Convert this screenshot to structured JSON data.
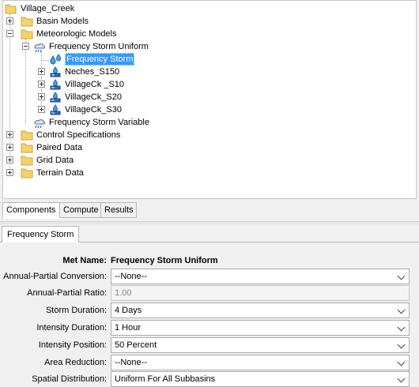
{
  "tree": {
    "root": "Village_Creek",
    "basin_models": "Basin Models",
    "meteorologic_models": "Meteorologic Models",
    "freq_storm_uniform": "Frequency Storm Uniform",
    "frequency_storm": "Frequency Storm",
    "neches_s150": "Neches_S150",
    "villageck_s10": "VillageCk _S10",
    "villageck_s20": "VillageCk_S20",
    "villageck_s30": "VillageCk_S30",
    "freq_storm_variable": "Frequency Storm Variable",
    "control_specifications": "Control Specifications",
    "paired_data": "Paired Data",
    "grid_data": "Grid Data",
    "terrain_data": "Terrain Data"
  },
  "tabs": {
    "components": "Components",
    "compute": "Compute",
    "results": "Results"
  },
  "editor": {
    "tab_title": "Frequency Storm",
    "met_name_label": "Met Name:",
    "met_name_value": "Frequency Storm Uniform",
    "annual_partial_conversion_label": "Annual-Partial Conversion:",
    "annual_partial_conversion_value": "--None--",
    "annual_partial_ratio_label": "Annual-Partial Ratio:",
    "annual_partial_ratio_value": "1.00",
    "storm_duration_label": "Storm Duration:",
    "storm_duration_value": "4 Days",
    "intensity_duration_label": "Intensity Duration:",
    "intensity_duration_value": "1 Hour",
    "intensity_position_label": "Intensity Position:",
    "intensity_position_value": "50 Percent",
    "area_reduction_label": "Area Reduction:",
    "area_reduction_value": "--None--",
    "spatial_distribution_label": "Spatial Distribution:",
    "spatial_distribution_value": "Uniform For All Subbasins"
  },
  "colors": {
    "selection": "#3399ff",
    "folder": "#f5d36b",
    "panel_bg": "#f0f0f0"
  }
}
